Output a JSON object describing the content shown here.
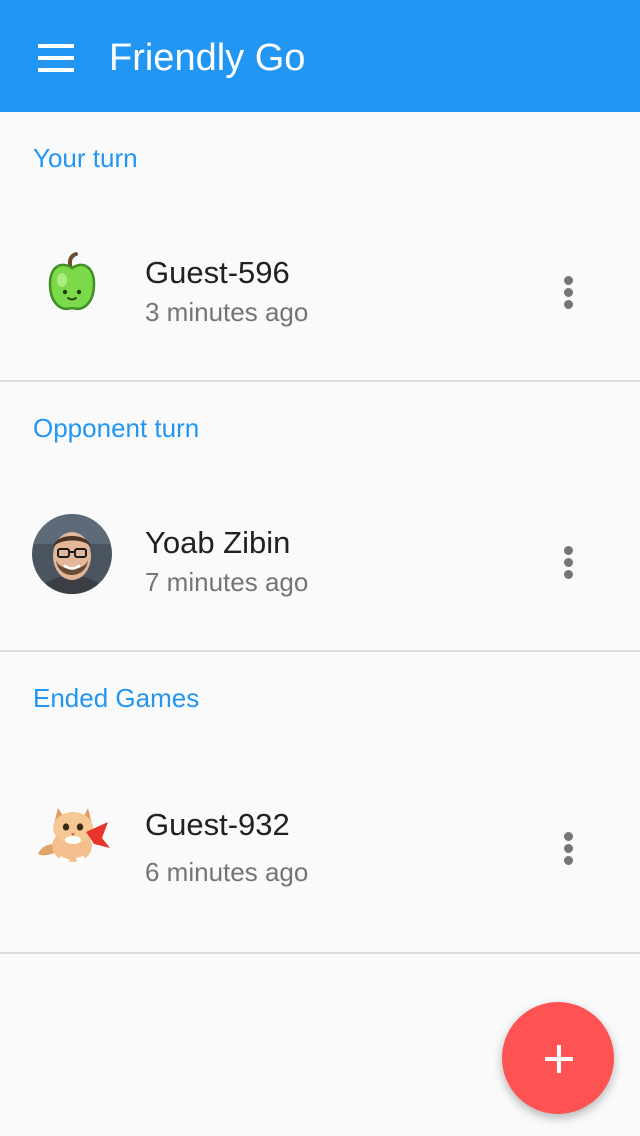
{
  "app_bar": {
    "title": "Friendly Go",
    "menu_icon": "hamburger-menu-icon",
    "color": "#2196f3"
  },
  "sections": [
    {
      "header": "Your turn",
      "games": [
        {
          "player": "Guest-596",
          "time": "3 minutes ago",
          "avatar": "green-apple-avatar"
        }
      ]
    },
    {
      "header": "Opponent turn",
      "games": [
        {
          "player": "Yoab Zibin",
          "time": "7 minutes ago",
          "avatar": "profile-photo-avatar"
        }
      ]
    },
    {
      "header": "Ended Games",
      "games": [
        {
          "player": "Guest-932",
          "time": "6 minutes ago",
          "avatar": "kitten-avatar"
        }
      ]
    }
  ],
  "row_action_icon": "more-vert-icon",
  "fab": {
    "icon": "plus-icon",
    "color": "#ff5252"
  },
  "colors": {
    "section_header": "#2196f3",
    "primary_text": "#212121",
    "secondary_text": "#757575",
    "divider": "#dcdcdc",
    "background": "#fafafa"
  }
}
